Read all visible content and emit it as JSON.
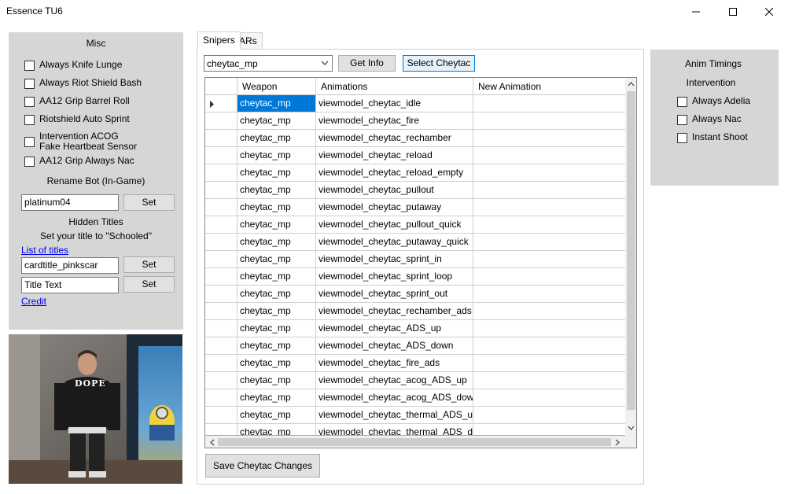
{
  "window": {
    "title": "Essence TU6"
  },
  "misc": {
    "header": "Misc",
    "checkboxes": [
      {
        "label": "Always Knife Lunge",
        "checked": false
      },
      {
        "label": "Always Riot Shield Bash",
        "checked": false
      },
      {
        "label": "AA12 Grip Barrel Roll",
        "checked": false
      },
      {
        "label": "Riotshield Auto Sprint",
        "checked": false
      },
      {
        "label": "Intervention ACOG\nFake Heartbeat Sensor",
        "checked": false
      },
      {
        "label": "AA12 Grip Always Nac",
        "checked": false
      }
    ],
    "rename_label": "Rename Bot (In-Game)",
    "rename_value": "platinum04",
    "set_label": "Set",
    "hidden_titles_label": "Hidden Titles",
    "set_title_hint": "Set your title to \"Schooled\"",
    "list_of_titles_link": "List of titles",
    "title_id_value": "cardtitle_pinkscar",
    "title_text_value": "Title Text",
    "credit_link": "Credit"
  },
  "tabs": [
    {
      "label": "Snipers",
      "active": true
    },
    {
      "label": "ARs",
      "active": false
    }
  ],
  "snipers": {
    "combo_value": "cheytac_mp",
    "get_info_label": "Get Info",
    "select_label": "Select Cheytac",
    "save_label": "Save Cheytac Changes",
    "columns": [
      "Weapon",
      "Animations",
      "New Animation"
    ],
    "rows": [
      {
        "weapon": "cheytac_mp",
        "animation": "viewmodel_cheytac_idle",
        "new": ""
      },
      {
        "weapon": "cheytac_mp",
        "animation": "viewmodel_cheytac_fire",
        "new": ""
      },
      {
        "weapon": "cheytac_mp",
        "animation": "viewmodel_cheytac_rechamber",
        "new": ""
      },
      {
        "weapon": "cheytac_mp",
        "animation": "viewmodel_cheytac_reload",
        "new": ""
      },
      {
        "weapon": "cheytac_mp",
        "animation": "viewmodel_cheytac_reload_empty",
        "new": ""
      },
      {
        "weapon": "cheytac_mp",
        "animation": "viewmodel_cheytac_pullout",
        "new": ""
      },
      {
        "weapon": "cheytac_mp",
        "animation": "viewmodel_cheytac_putaway",
        "new": ""
      },
      {
        "weapon": "cheytac_mp",
        "animation": "viewmodel_cheytac_pullout_quick",
        "new": ""
      },
      {
        "weapon": "cheytac_mp",
        "animation": "viewmodel_cheytac_putaway_quick",
        "new": ""
      },
      {
        "weapon": "cheytac_mp",
        "animation": "viewmodel_cheytac_sprint_in",
        "new": ""
      },
      {
        "weapon": "cheytac_mp",
        "animation": "viewmodel_cheytac_sprint_loop",
        "new": ""
      },
      {
        "weapon": "cheytac_mp",
        "animation": "viewmodel_cheytac_sprint_out",
        "new": ""
      },
      {
        "weapon": "cheytac_mp",
        "animation": "viewmodel_cheytac_rechamber_ads",
        "new": ""
      },
      {
        "weapon": "cheytac_mp",
        "animation": "viewmodel_cheytac_ADS_up",
        "new": ""
      },
      {
        "weapon": "cheytac_mp",
        "animation": "viewmodel_cheytac_ADS_down",
        "new": ""
      },
      {
        "weapon": "cheytac_mp",
        "animation": "viewmodel_cheytac_fire_ads",
        "new": ""
      },
      {
        "weapon": "cheytac_mp",
        "animation": "viewmodel_cheytac_acog_ADS_up",
        "new": ""
      },
      {
        "weapon": "cheytac_mp",
        "animation": "viewmodel_cheytac_acog_ADS_down",
        "new": ""
      },
      {
        "weapon": "cheytac_mp",
        "animation": "viewmodel_cheytac_thermal_ADS_up",
        "new": ""
      },
      {
        "weapon": "cheytac_mp",
        "animation": "viewmodel_cheytac_thermal_ADS_do",
        "new": ""
      }
    ]
  },
  "anim": {
    "header": "Anim Timings",
    "subheader": "Intervention",
    "checkboxes": [
      {
        "label": "Always Adelia",
        "checked": false
      },
      {
        "label": "Always Nac",
        "checked": false
      },
      {
        "label": "Instant Shoot",
        "checked": false
      }
    ]
  },
  "photo": {
    "shirt_text": "DOPE"
  },
  "colors": {
    "panel": "#d6d6d6",
    "selection": "#0078d7",
    "link": "#0000ee"
  }
}
